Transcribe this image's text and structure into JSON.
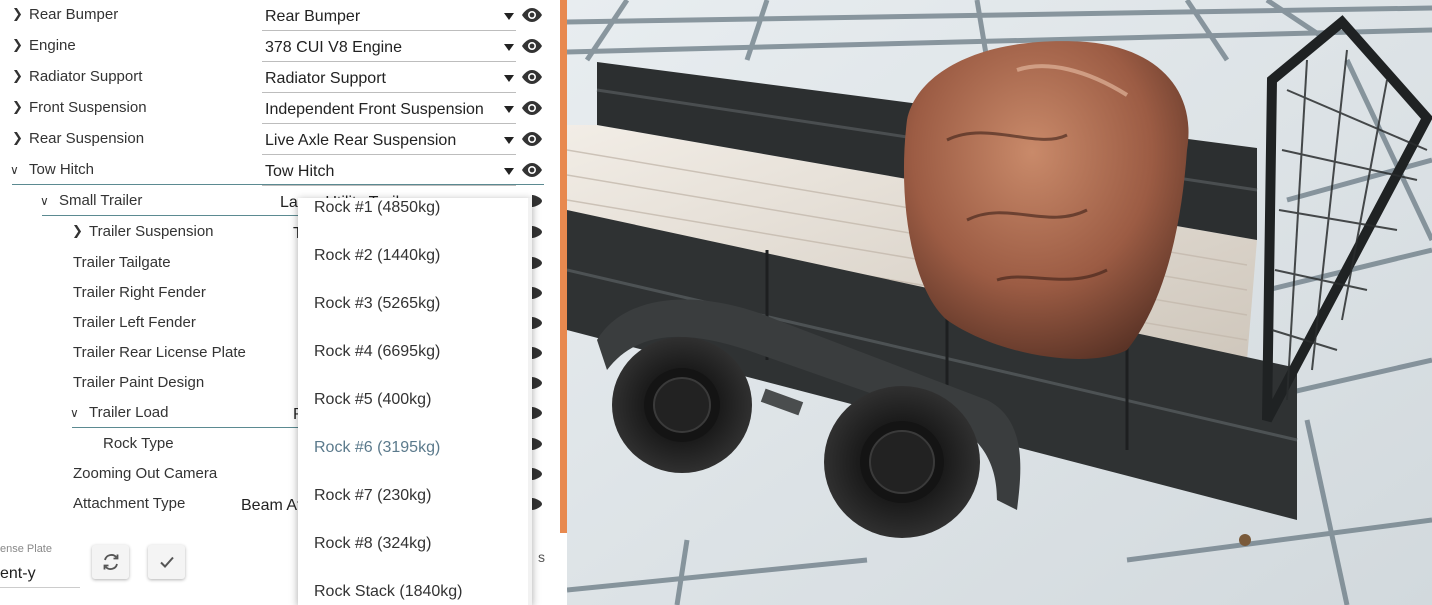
{
  "parts": [
    {
      "label": "Rear Bumper",
      "value": "Rear Bumper"
    },
    {
      "label": "Engine",
      "value": "378 CUI V8 Engine"
    },
    {
      "label": "Radiator Support",
      "value": "Radiator Support"
    },
    {
      "label": "Front Suspension",
      "value": "Independent Front Suspension"
    },
    {
      "label": "Rear Suspension",
      "value": "Live Axle Rear Suspension"
    },
    {
      "label": "Tow Hitch",
      "value": "Tow Hitch"
    },
    {
      "label": "Small Trailer",
      "value": "Large Utility Trailer"
    },
    {
      "label": "Trailer Suspension",
      "value": "T"
    },
    {
      "label": "Trailer Tailgate"
    },
    {
      "label": "Trailer Right Fender"
    },
    {
      "label": "Trailer Left Fender"
    },
    {
      "label": "Trailer Rear License Plate"
    },
    {
      "label": "Trailer Paint Design"
    },
    {
      "label": "Trailer Load",
      "value": "R"
    },
    {
      "label": "Rock Type"
    },
    {
      "label": "Zooming Out Camera"
    },
    {
      "label": "Attachment Type",
      "value": "Beam At"
    }
  ],
  "dropdown": {
    "options": [
      "Rock #1 (4850kg)",
      "Rock #2 (1440kg)",
      "Rock #3 (5265kg)",
      "Rock #4 (6695kg)",
      "Rock #5 (400kg)",
      "Rock #6 (3195kg)",
      "Rock #7 (230kg)",
      "Rock #8 (324kg)",
      "Rock Stack (1840kg)"
    ],
    "selected": "Rock #6 (3195kg)"
  },
  "bottom": {
    "license_caption": "ense Plate",
    "license_value": "ent-y",
    "stray_text": "s"
  },
  "icons": {
    "expand": "chevron-right-icon",
    "collapse": "chevron-down-icon",
    "visibility": "eye-icon",
    "refresh": "refresh-icon",
    "apply": "checkmark-icon"
  },
  "colors": {
    "accent": "#e8894f",
    "selected_option": "#5b7a8c",
    "active_underline": "#5b8a91"
  }
}
